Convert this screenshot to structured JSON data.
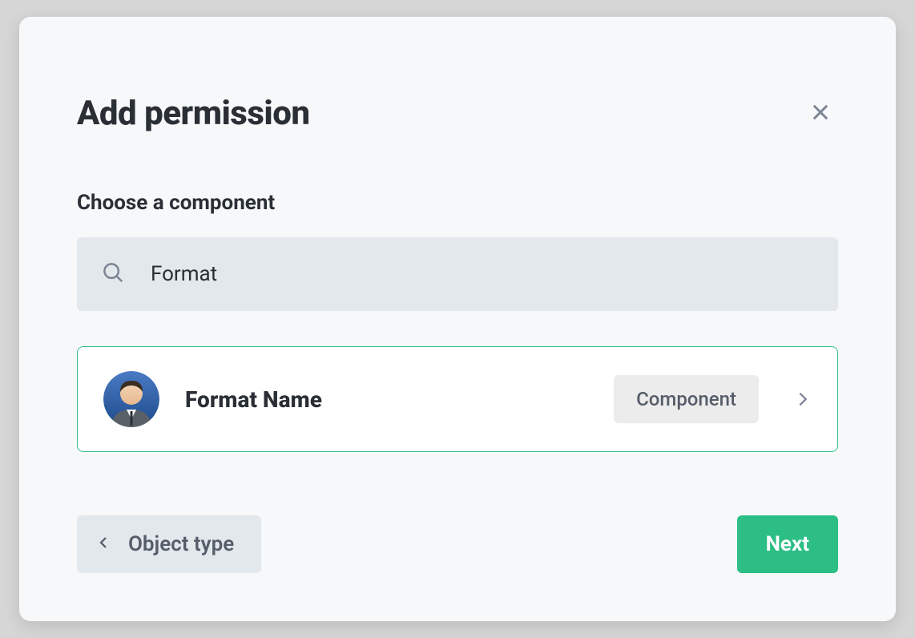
{
  "modal": {
    "title": "Add permission",
    "section_label": "Choose a component",
    "search": {
      "value": "Format"
    },
    "result": {
      "name": "Format Name",
      "badge": "Component"
    },
    "footer": {
      "back_label": "Object type",
      "next_label": "Next"
    }
  }
}
